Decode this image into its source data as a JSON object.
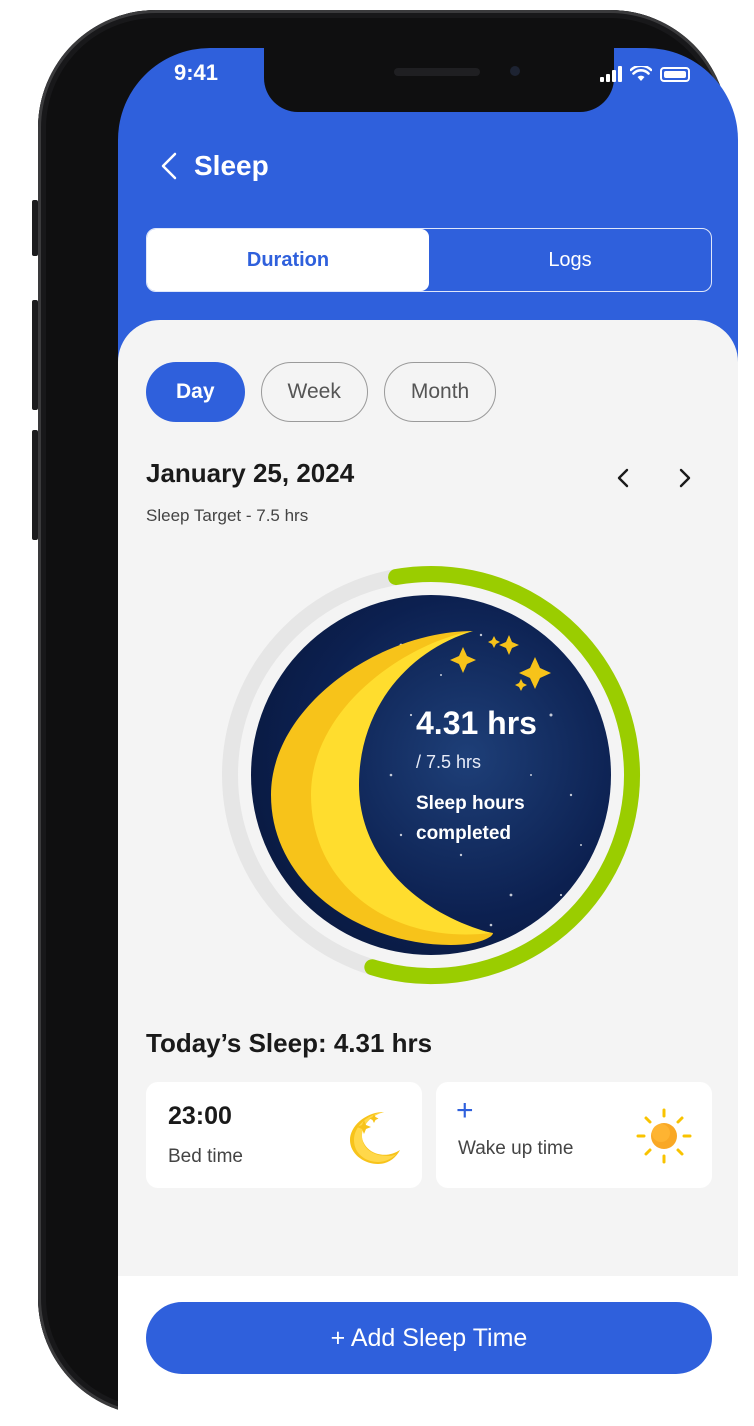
{
  "status_bar": {
    "time": "9:41"
  },
  "header": {
    "title": "Sleep"
  },
  "segmented": {
    "tabs": [
      "Duration",
      "Logs"
    ],
    "active": "Duration"
  },
  "period": {
    "options": [
      "Day",
      "Week",
      "Month"
    ],
    "active": "Day"
  },
  "date_header": {
    "date": "January 25, 2024",
    "target": "Sleep Target - 7.5 hrs"
  },
  "progress": {
    "hours": "4.31 hrs",
    "target": "7.5 hrs",
    "caption_line1": "Sleep hours",
    "caption_line2": "completed",
    "fraction": 0.5747,
    "track_color": "#e6e6e6",
    "fill_color": "#9acd00"
  },
  "today": {
    "label": "Today’s Sleep: 4.31 hrs"
  },
  "bed_card": {
    "time": "23:00",
    "label": "Bed time"
  },
  "wake_card": {
    "plus": "+",
    "label": "Wake up time"
  },
  "add_button": {
    "label": "+ Add Sleep Time"
  },
  "icons": [
    "back-chevron-icon",
    "prev-chevron-icon",
    "next-chevron-icon",
    "signal-icon",
    "wifi-icon",
    "battery-icon",
    "moon-stars-icon",
    "sun-icon"
  ],
  "colors": {
    "primary": "#2f60dc",
    "moon": "#ffd43a",
    "ring_fill": "#9acd00"
  }
}
